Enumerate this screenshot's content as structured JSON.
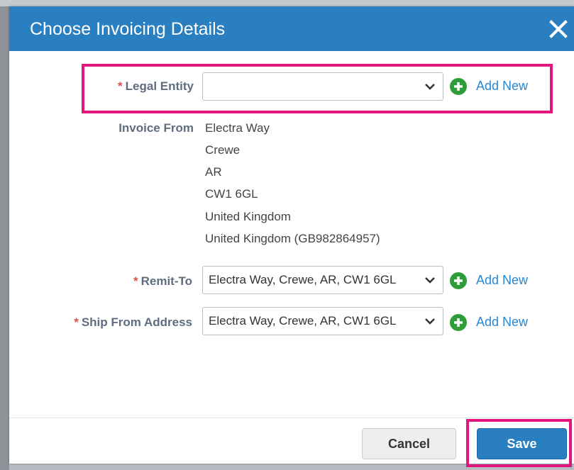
{
  "dialog": {
    "title": "Choose Invoicing Details",
    "close_icon": "close-icon"
  },
  "legal_entity": {
    "required_mark": "*",
    "label": "Legal Entity",
    "value": "",
    "add_new": "Add New"
  },
  "invoice_from": {
    "label": "Invoice From",
    "lines": [
      "Electra Way",
      "Crewe",
      "AR",
      "CW1 6GL",
      "United Kingdom",
      "United Kingdom (GB982864957)"
    ]
  },
  "remit_to": {
    "required_mark": "*",
    "label": "Remit-To",
    "value": "Electra Way, Crewe, AR, CW1 6GL",
    "add_new": "Add New"
  },
  "ship_from": {
    "required_mark": "*",
    "label": "Ship From Address",
    "value": "Electra Way, Crewe, AR, CW1 6GL",
    "add_new": "Add New"
  },
  "footer": {
    "cancel_label": "Cancel",
    "save_label": "Save"
  },
  "colors": {
    "header": "#2a7fc1",
    "highlight": "#e0167e",
    "add_icon": "#2f9e3a",
    "link": "#2a86d1"
  }
}
